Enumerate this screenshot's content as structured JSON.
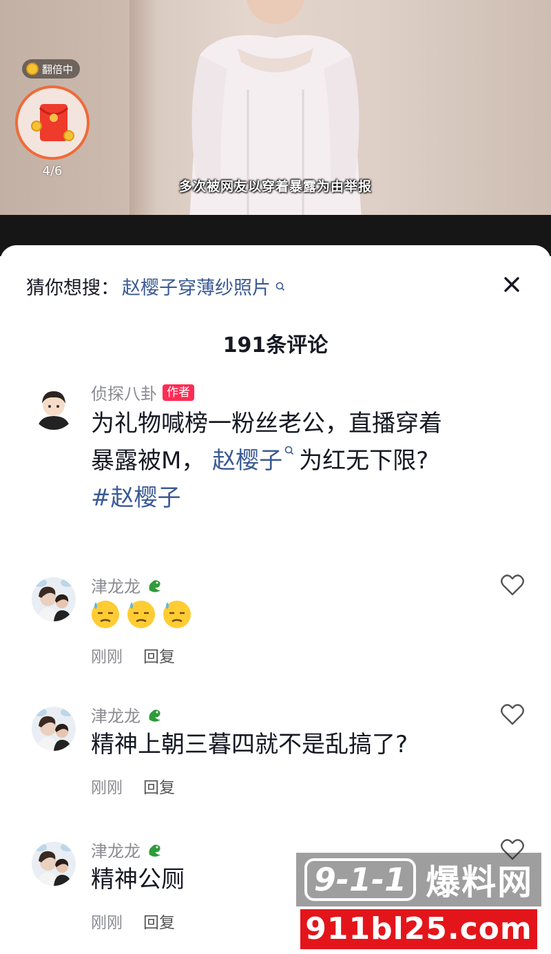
{
  "video": {
    "caption": "多次被网友以穿着暴露为由举报",
    "bonus_badge": "翻倍中",
    "bonus_counter": "4/6",
    "bonus_icon": "red-envelope-icon"
  },
  "sheet": {
    "suggest_label": "猜你想搜：",
    "suggest_keyword": "赵樱子穿薄纱照片",
    "comment_count_title": "191条评论"
  },
  "author_post": {
    "name": "侦探八卦",
    "badge": "作者",
    "line1": "为礼物喊榜一粉丝老公，直播穿着",
    "line2_prefix": "暴露被M，",
    "line2_link": "赵樱子",
    "line2_suffix": "为红无下限?",
    "hashtag": "#赵樱子"
  },
  "comments": [
    {
      "name": "津龙龙",
      "emoji": [
        "😓",
        "😓",
        "😓"
      ],
      "time": "刚刚",
      "reply": "回复"
    },
    {
      "name": "津龙龙",
      "text": "精神上朝三暮四就不是乱搞了?",
      "time": "刚刚",
      "reply": "回复"
    },
    {
      "name": "津龙龙",
      "text": "精神公厕",
      "time": "刚刚",
      "reply": "回复"
    }
  ],
  "watermark": {
    "logo_num": "9-1-1",
    "logo_text": "爆料网",
    "url": "911bl25.com"
  },
  "colors": {
    "accent_link": "#3a5a94",
    "author_badge": "#fe2c55",
    "watermark_red": "#e3151b"
  }
}
